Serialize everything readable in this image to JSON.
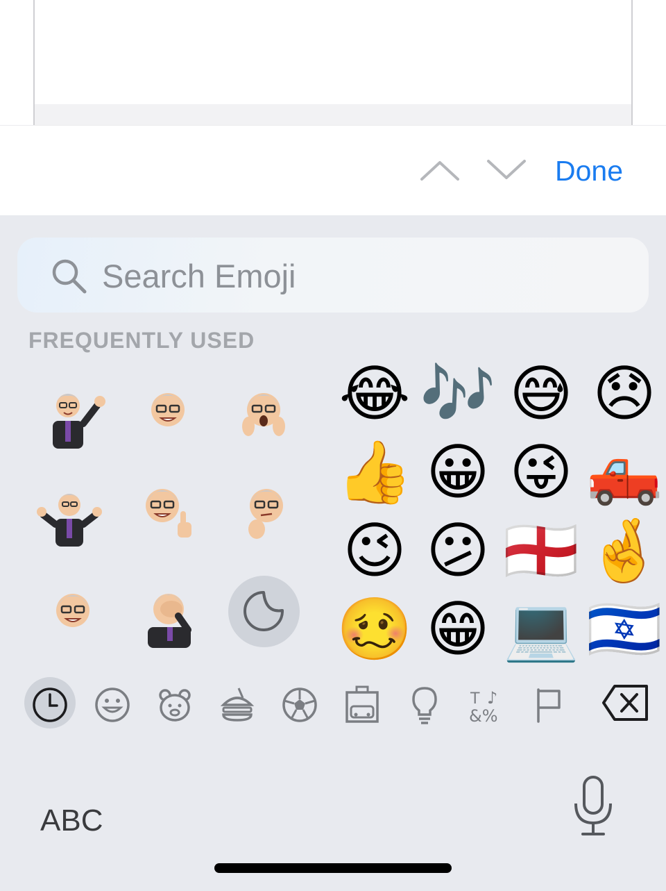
{
  "toolbar": {
    "previous_icon": "chevron-up-icon",
    "next_icon": "chevron-down-icon",
    "done_label": "Done",
    "accent_color": "#1a7cf0"
  },
  "keyboard": {
    "search": {
      "placeholder": "Search Emoji",
      "icon": "search-icon"
    },
    "section_title": "FREQUENTLY USED",
    "memoji_stickers": [
      "memoji-waving",
      "memoji-smiling",
      "memoji-shocked",
      "memoji-shrugging",
      "memoji-thumbs-up",
      "memoji-thinking",
      "memoji-winking",
      "memoji-facepalm"
    ],
    "sticker_button_icon": "sticker-icon",
    "emojis": [
      "😂",
      "🎶",
      "😅",
      "😞",
      "👍",
      "😀",
      "😜",
      "🛻",
      "😉",
      "😕",
      "🏴󠁧󠁢󠁥󠁮󠁧󠁿",
      "🤞",
      "🥴",
      "😁",
      "💻",
      "🇮🇱"
    ],
    "categories": [
      "recent-clock-icon",
      "smileys-icon",
      "animals-icon",
      "food-icon",
      "activity-icon",
      "travel-icon",
      "objects-icon",
      "symbols-icon",
      "flags-icon"
    ],
    "delete_icon": "delete-icon",
    "abc_label": "ABC",
    "mic_icon": "microphone-icon"
  }
}
